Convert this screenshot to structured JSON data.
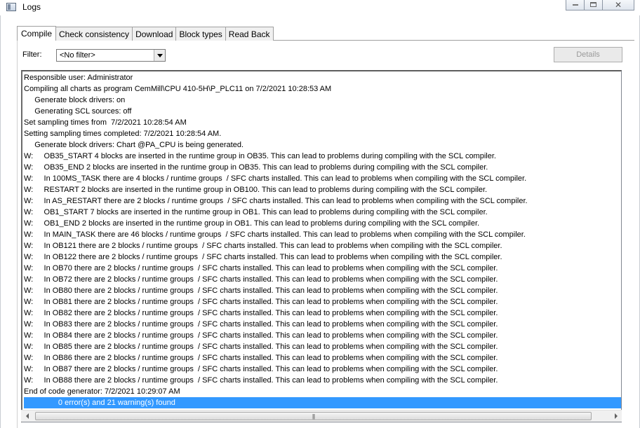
{
  "window": {
    "title": "Logs",
    "close_symbol": "✕"
  },
  "tabs": [
    {
      "label": "Compile",
      "active": true
    },
    {
      "label": "Check consistency",
      "active": false
    },
    {
      "label": "Download",
      "active": false
    },
    {
      "label": "Block types",
      "active": false
    },
    {
      "label": "Read Back",
      "active": false
    }
  ],
  "filter": {
    "label": "Filter:",
    "value": "<No filter>"
  },
  "details_button": {
    "label": "Details",
    "enabled": false
  },
  "log": {
    "lines": [
      "Responsible user: Administrator",
      "Compiling all charts as program CemMill\\CPU 410-5H\\P_PLC11 on 7/2/2021 10:28:53 AM",
      "     Generate block drivers: on",
      "     Generating SCL sources: off",
      "Set sampling times from  7/2/2021 10:28:54 AM",
      "Setting sampling times completed: 7/2/2021 10:28:54 AM.",
      "     Generate block drivers: Chart @PA_CPU is being generated.",
      "W:     OB35_START 4 blocks are inserted in the runtime group in OB35. This can lead to problems during compiling with the SCL compiler.",
      "W:     OB35_END 2 blocks are inserted in the runtime group in OB35. This can lead to problems during compiling with the SCL compiler.",
      "W:     In 100MS_TASK there are 4 blocks / runtime groups  / SFC charts installed. This can lead to problems when compiling with the SCL compiler.",
      "W:     RESTART 2 blocks are inserted in the runtime group in OB100. This can lead to problems during compiling with the SCL compiler.",
      "W:     In AS_RESTART there are 2 blocks / runtime groups  / SFC charts installed. This can lead to problems when compiling with the SCL compiler.",
      "W:     OB1_START 7 blocks are inserted in the runtime group in OB1. This can lead to problems during compiling with the SCL compiler.",
      "W:     OB1_END 2 blocks are inserted in the runtime group in OB1. This can lead to problems during compiling with the SCL compiler.",
      "W:     In MAIN_TASK there are 46 blocks / runtime groups  / SFC charts installed. This can lead to problems when compiling with the SCL compiler.",
      "W:     In OB121 there are 2 blocks / runtime groups  / SFC charts installed. This can lead to problems when compiling with the SCL compiler.",
      "W:     In OB122 there are 2 blocks / runtime groups  / SFC charts installed. This can lead to problems when compiling with the SCL compiler.",
      "W:     In OB70 there are 2 blocks / runtime groups  / SFC charts installed. This can lead to problems when compiling with the SCL compiler.",
      "W:     In OB72 there are 2 blocks / runtime groups  / SFC charts installed. This can lead to problems when compiling with the SCL compiler.",
      "W:     In OB80 there are 2 blocks / runtime groups  / SFC charts installed. This can lead to problems when compiling with the SCL compiler.",
      "W:     In OB81 there are 2 blocks / runtime groups  / SFC charts installed. This can lead to problems when compiling with the SCL compiler.",
      "W:     In OB82 there are 2 blocks / runtime groups  / SFC charts installed. This can lead to problems when compiling with the SCL compiler.",
      "W:     In OB83 there are 2 blocks / runtime groups  / SFC charts installed. This can lead to problems when compiling with the SCL compiler.",
      "W:     In OB84 there are 2 blocks / runtime groups  / SFC charts installed. This can lead to problems when compiling with the SCL compiler.",
      "W:     In OB85 there are 2 blocks / runtime groups  / SFC charts installed. This can lead to problems when compiling with the SCL compiler.",
      "W:     In OB86 there are 2 blocks / runtime groups  / SFC charts installed. This can lead to problems when compiling with the SCL compiler.",
      "W:     In OB87 there are 2 blocks / runtime groups  / SFC charts installed. This can lead to problems when compiling with the SCL compiler.",
      "W:     In OB88 there are 2 blocks / runtime groups  / SFC charts installed. This can lead to problems when compiling with the SCL compiler.",
      "End of code generator: 7/2/2021 10:29:07 AM",
      "                0 error(s) and 21 warning(s) found"
    ],
    "selected_index": 29
  },
  "scrollbar": {
    "grip": "|||"
  },
  "colors": {
    "selection": "#3399ff",
    "selection_text": "#ffffff"
  }
}
